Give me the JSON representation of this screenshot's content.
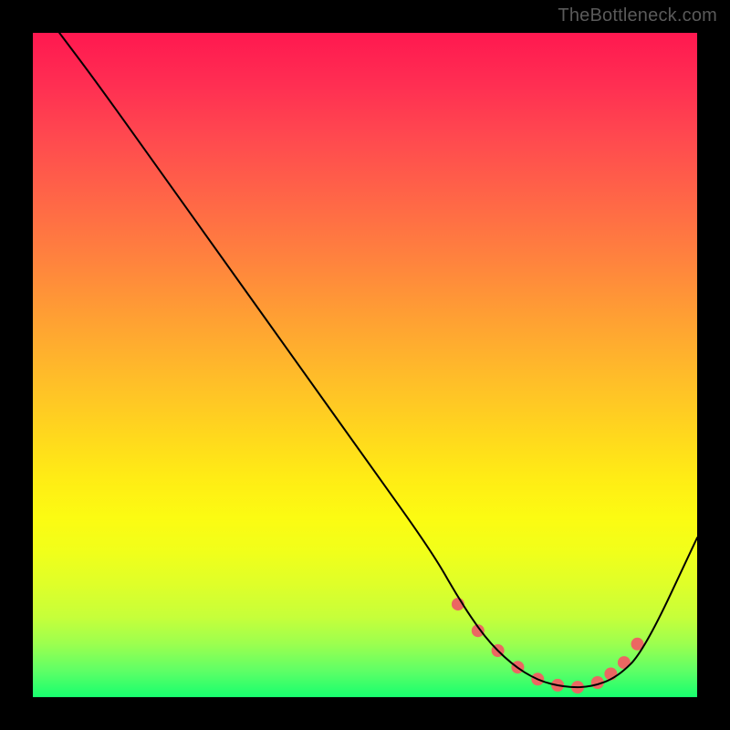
{
  "watermark": "TheBottleneck.com",
  "chart_data": {
    "type": "line",
    "title": "",
    "xlabel": "",
    "ylabel": "",
    "xlim": [
      0,
      100
    ],
    "ylim": [
      0,
      100
    ],
    "grid": false,
    "legend": false,
    "series": [
      {
        "name": "curve",
        "x": [
          4,
          10,
          20,
          30,
          40,
          50,
          60,
          64,
          68,
          72,
          76,
          80,
          84,
          88,
          92,
          100
        ],
        "y": [
          100,
          92,
          78,
          64,
          50,
          36,
          22,
          15,
          9,
          5,
          2.5,
          1.5,
          1.5,
          3,
          7,
          24
        ],
        "stroke": "#000000",
        "stroke_width": 2
      }
    ],
    "markers": {
      "name": "highlight-dots",
      "x": [
        64,
        67,
        70,
        73,
        76,
        79,
        82,
        85,
        87,
        89,
        91
      ],
      "y": [
        14,
        10,
        7,
        4.5,
        2.7,
        1.8,
        1.5,
        2.2,
        3.5,
        5.2,
        8
      ],
      "color": "#eb6762",
      "radius": 7
    }
  }
}
